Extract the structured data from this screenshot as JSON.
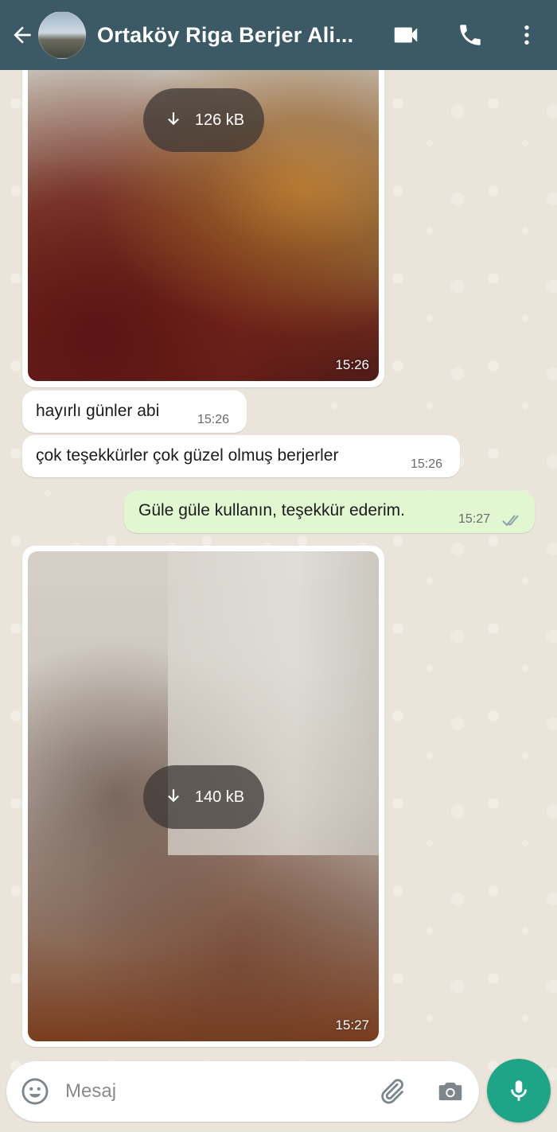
{
  "header": {
    "title": "Ortaköy Riga Berjer Ali..."
  },
  "messages": {
    "media_1": {
      "size": "126 kB",
      "time": "15:26"
    },
    "text_1": {
      "text": "hayırlı günler abi",
      "time": "15:26"
    },
    "text_2": {
      "text": "çok teşekkürler çok güzel olmuş berjerler",
      "time": "15:26"
    },
    "text_3": {
      "text": "Güle güle kullanın, teşekkür ederim.",
      "time": "15:27"
    },
    "media_2": {
      "size": "140 kB",
      "time": "15:27"
    }
  },
  "composer": {
    "placeholder": "Mesaj"
  },
  "colors": {
    "header_bg": "#3b5a66",
    "outgoing_bubble": "#e1f7d1",
    "mic_button": "#1ea588",
    "read_ticks": "#8aa0aa"
  },
  "icons": [
    "back-arrow-icon",
    "video-call-icon",
    "phone-icon",
    "more-options-icon",
    "download-icon",
    "double-check-icon",
    "emoji-icon",
    "attach-icon",
    "camera-icon",
    "mic-icon"
  ]
}
